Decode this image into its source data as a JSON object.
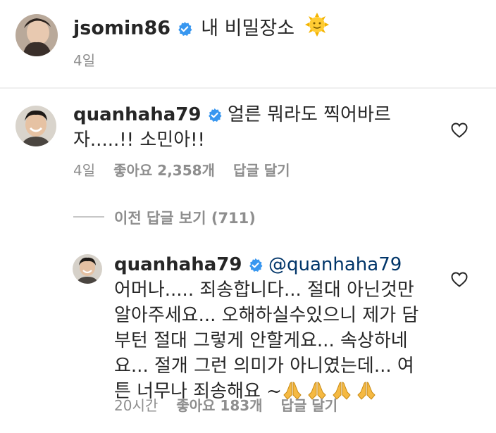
{
  "post": {
    "username": "jsomin86",
    "caption": "내 비밀장소",
    "time": "4일"
  },
  "comment": {
    "username": "quanhaha79",
    "text": "얼른 뭐라도 찍어바르자.....!! 소민아!!",
    "time": "4일",
    "likes": "좋아요 2,358개",
    "reply_label": "답글 달기"
  },
  "view_replies": "이전 답글 보기 (711)",
  "reply": {
    "username": "quanhaha79",
    "mention": "@quanhaha79",
    "text": "어머나..... 죄송합니다... 절대 아닌것만알아주세요... 오해하실수있으니 제가 담부턴 절대 그렇게 안할게요... 속상하네요... 절개 그런 의미가 아니였는데... 여튼 너무나 죄송해요 ~",
    "time": "20시간",
    "likes": "좋아요 183개",
    "reply_label": "답글 달기"
  },
  "colors": {
    "verified": "#3897f0",
    "mention": "#003569",
    "muted": "#8e8e8e"
  },
  "icons": [
    "verified-badge-icon",
    "sun-emoji-icon",
    "heart-icon",
    "folded-hands-icon"
  ]
}
